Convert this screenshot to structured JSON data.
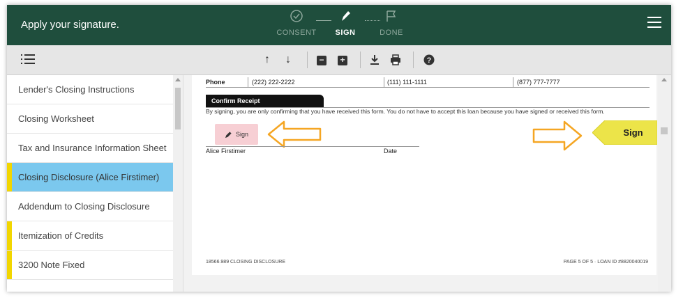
{
  "header": {
    "title": "Apply your signature.",
    "steps": [
      {
        "label": "CONSENT",
        "icon": "check-circle-icon",
        "state": "inactive"
      },
      {
        "label": "SIGN",
        "icon": "pen-icon",
        "state": "active"
      },
      {
        "label": "DONE",
        "icon": "finish-flag-icon",
        "state": "inactive"
      }
    ]
  },
  "toolbar": {
    "buttons": [
      "arrow-up-icon",
      "arrow-down-icon",
      "zoom-out-icon",
      "zoom-in-icon",
      "download-icon",
      "print-icon",
      "help-icon"
    ]
  },
  "sidebar": {
    "items": [
      {
        "label": "Lender's Closing Instructions",
        "marked": false,
        "active": false
      },
      {
        "label": "Closing Worksheet",
        "marked": false,
        "active": false
      },
      {
        "label": "Tax and Insurance Information Sheet",
        "marked": false,
        "active": false
      },
      {
        "label": "Closing Disclosure (Alice Firstimer)",
        "marked": true,
        "active": true
      },
      {
        "label": "Addendum to Closing Disclosure",
        "marked": false,
        "active": false
      },
      {
        "label": "Itemization of Credits",
        "marked": true,
        "active": false
      },
      {
        "label": "3200 Note Fixed",
        "marked": true,
        "active": false
      }
    ]
  },
  "document": {
    "phone_row": {
      "label": "Phone",
      "values": [
        "(222) 222-2222",
        "(111) 111-1111",
        "(877) 777-7777"
      ]
    },
    "confirm_title": "Confirm Receipt",
    "consent_text": "By signing, you are only confirming that you have received this form. You do not have to accept this loan because you have signed or received this form.",
    "sign_field_label": "Sign",
    "signer_name": "Alice Firstimer",
    "date_label": "Date",
    "footer_left": "18566.989   CLOSING DISCLOSURE",
    "footer_right": "PAGE 5 OF 5 · LOAN ID #8820040019"
  },
  "sign_tag": {
    "label": "Sign"
  },
  "colors": {
    "header_bg": "#1f4e3d",
    "active_item": "#7bc8ee",
    "marker": "#f2d600",
    "sign_field": "#f7cfd4",
    "sign_tag": "#ece449",
    "arrow": "#f5a623"
  }
}
